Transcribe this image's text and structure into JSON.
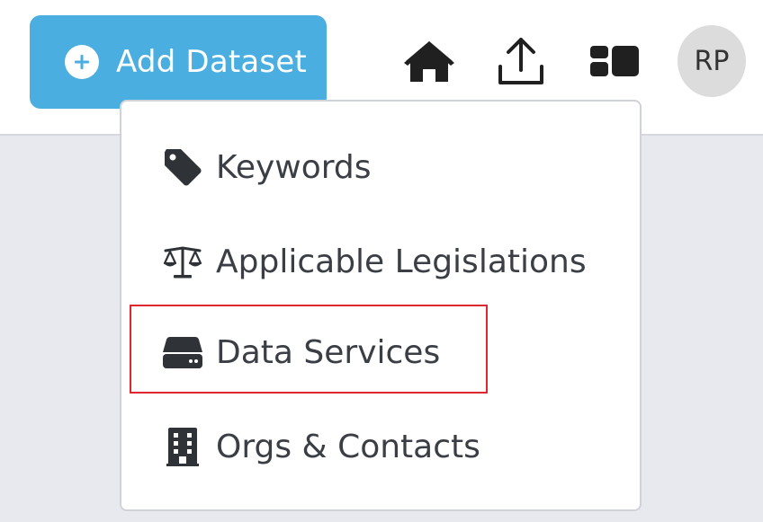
{
  "header": {
    "add_dataset_label": "Add Dataset",
    "avatar_initials": "RP"
  },
  "menu": {
    "items": [
      {
        "label": "Keywords",
        "icon": "tag-icon"
      },
      {
        "label": "Applicable Legislations",
        "icon": "balance-scale-icon"
      },
      {
        "label": "Data Services",
        "icon": "server-drive-icon"
      },
      {
        "label": "Orgs & Contacts",
        "icon": "building-icon"
      }
    ]
  },
  "colors": {
    "accent": "#4aaee0",
    "highlight": "#e0262e",
    "text": "#3b3f45",
    "background": "#e8e9ee"
  }
}
